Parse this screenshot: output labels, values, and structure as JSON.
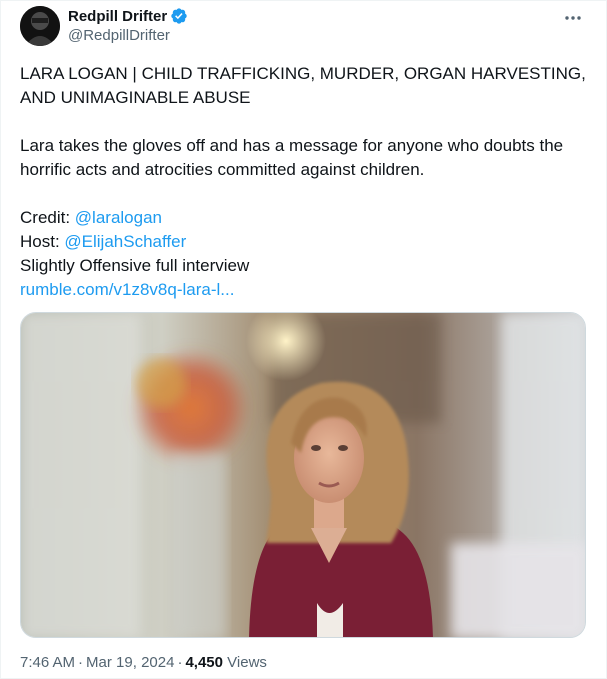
{
  "author": {
    "display_name": "Redpill Drifter",
    "handle": "@RedpillDrifter",
    "verified": true,
    "verified_color": "#1d9bf0"
  },
  "tweet": {
    "title_line": "LARA LOGAN | CHILD TRAFFICKING, MURDER, ORGAN HARVESTING, AND UNIMAGINABLE ABUSE",
    "body": "Lara takes the gloves off and has a message for anyone who doubts the horrific acts and atrocities committed against children.",
    "credit_label": "Credit: ",
    "credit_link": "@laralogan",
    "host_label": "Host: ",
    "host_link": "@ElijahSchaffer",
    "interview_line": "Slightly Offensive full interview",
    "url": "rumble.com/v1z8v8q-lara-l..."
  },
  "meta": {
    "time": "7:46 AM",
    "separator": "·",
    "date": "Mar 19, 2024",
    "views_count": "4,450",
    "views_label": "Views"
  },
  "icons": {
    "more": "more-horizontal-icon",
    "verified": "verified-badge-icon"
  },
  "colors": {
    "link": "#1d9bf0",
    "secondary_text": "#536471",
    "primary_text": "#0f1419"
  }
}
